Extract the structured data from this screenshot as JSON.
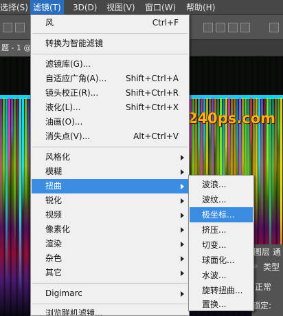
{
  "menubar": {
    "items": [
      "选择(S)",
      "滤镜(T)",
      "3D(D)",
      "视图(V)",
      "窗口(W)",
      "帮助(H)"
    ],
    "active_index": 1
  },
  "document_tab": {
    "label": "题 - 1 @"
  },
  "watermark": "www.240ps.com",
  "filter_menu": {
    "items": [
      {
        "label": "风",
        "shortcut": "Ctrl+F"
      },
      {
        "label": "转换为智能滤镜"
      },
      {
        "label": "滤镜库(G)..."
      },
      {
        "label": "自适应广角(A)...",
        "shortcut": "Shift+Ctrl+A"
      },
      {
        "label": "镜头校正(R)...",
        "shortcut": "Shift+Ctrl+R"
      },
      {
        "label": "液化(L)...",
        "shortcut": "Shift+Ctrl+X"
      },
      {
        "label": "油画(O)..."
      },
      {
        "label": "消失点(V)...",
        "shortcut": "Alt+Ctrl+V"
      },
      {
        "label": "风格化",
        "submenu": true
      },
      {
        "label": "模糊",
        "submenu": true
      },
      {
        "label": "扭曲",
        "submenu": true,
        "highlighted": true
      },
      {
        "label": "锐化",
        "submenu": true
      },
      {
        "label": "视频",
        "submenu": true
      },
      {
        "label": "像素化",
        "submenu": true
      },
      {
        "label": "渲染",
        "submenu": true
      },
      {
        "label": "杂色",
        "submenu": true
      },
      {
        "label": "其它",
        "submenu": true
      },
      {
        "label": "Digimarc",
        "submenu": true
      },
      {
        "label": "浏览联机滤镜..."
      }
    ]
  },
  "distort_submenu": {
    "items": [
      "波浪...",
      "波纹...",
      "极坐标...",
      "挤压...",
      "切变...",
      "球面化...",
      "水波...",
      "旋转扭曲...",
      "置换..."
    ],
    "highlighted_index": 2
  },
  "right_panel": {
    "layers_tab": "图层",
    "channels_tab": "通",
    "kind_label": "类型",
    "blend_mode": "正常",
    "lock_label": "锁定:"
  },
  "colors": {
    "menu_highlight": "#3a8de0",
    "menubar_active": "#2a6fbf",
    "watermark": "#ffb218"
  }
}
